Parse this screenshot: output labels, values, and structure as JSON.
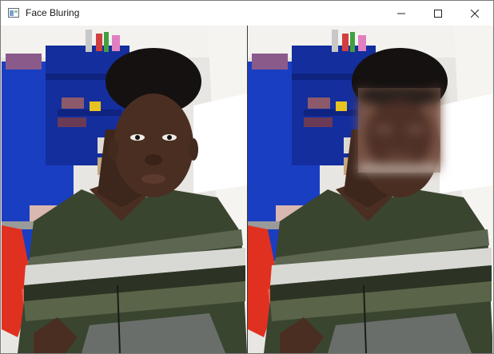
{
  "window": {
    "title": "Face Bluring",
    "icons": {
      "app": "opencv-window-icon",
      "minimize": "minimize-icon",
      "maximize": "maximize-icon",
      "close": "close-icon"
    }
  },
  "panels": [
    {
      "name": "original-frame",
      "face_blurred": false
    },
    {
      "name": "blurred-frame",
      "face_blurred": true
    }
  ],
  "colors": {
    "wall_blue": "#1a3ec2",
    "shelf_blue": "#142e9e",
    "wall_white": "#eceae6",
    "sweater_dark": "#3a4530",
    "sweater_stripe": "#d8d8d4",
    "skin": "#4a2e22",
    "hair": "#141110"
  }
}
